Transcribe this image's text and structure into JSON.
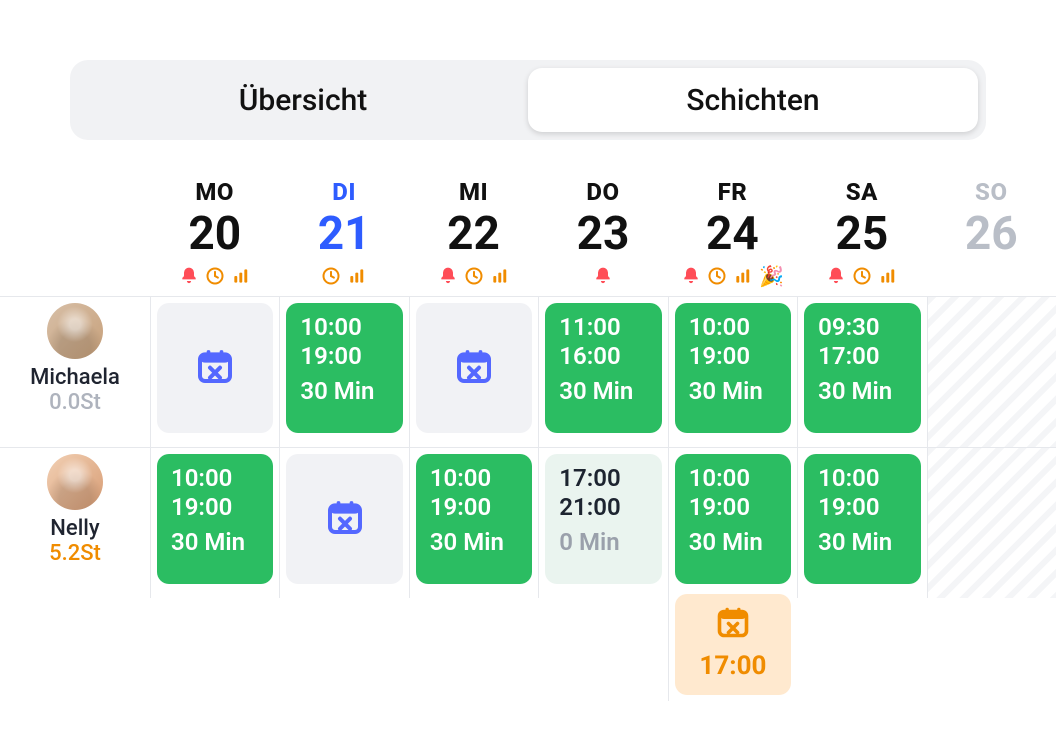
{
  "tabs": {
    "overview": "Übersicht",
    "shifts": "Schichten",
    "active": "shifts"
  },
  "days": [
    {
      "dow": "MO",
      "num": "20",
      "today": false,
      "muted": false,
      "inds": [
        "bell",
        "clock",
        "bars"
      ]
    },
    {
      "dow": "DI",
      "num": "21",
      "today": true,
      "muted": false,
      "inds": [
        "clock",
        "bars"
      ]
    },
    {
      "dow": "MI",
      "num": "22",
      "today": false,
      "muted": false,
      "inds": [
        "bell",
        "clock",
        "bars"
      ]
    },
    {
      "dow": "DO",
      "num": "23",
      "today": false,
      "muted": false,
      "inds": [
        "bell"
      ]
    },
    {
      "dow": "FR",
      "num": "24",
      "today": false,
      "muted": false,
      "inds": [
        "bell",
        "clock",
        "bars",
        "party"
      ]
    },
    {
      "dow": "SA",
      "num": "25",
      "today": false,
      "muted": false,
      "inds": [
        "bell",
        "clock",
        "bars"
      ]
    },
    {
      "dow": "SO",
      "num": "26",
      "today": false,
      "muted": true,
      "inds": []
    }
  ],
  "employees": [
    {
      "name": "Michaela",
      "hours": "0.0St",
      "hoursColor": "gray",
      "cells": [
        {
          "type": "busy"
        },
        {
          "type": "shift",
          "start": "10:00",
          "end": "19:00",
          "dur": "30 Min",
          "variant": "green"
        },
        {
          "type": "busy"
        },
        {
          "type": "shift",
          "start": "11:00",
          "end": "16:00",
          "dur": "30 Min",
          "variant": "green"
        },
        {
          "type": "shift",
          "start": "10:00",
          "end": "19:00",
          "dur": "30 Min",
          "variant": "green"
        },
        {
          "type": "shift",
          "start": "09:30",
          "end": "17:00",
          "dur": "30 Min",
          "variant": "green"
        },
        {
          "type": "hatched"
        }
      ]
    },
    {
      "name": "Nelly",
      "hours": "5.2St",
      "hoursColor": "orange",
      "cells": [
        {
          "type": "shift",
          "start": "10:00",
          "end": "19:00",
          "dur": "30 Min",
          "variant": "green"
        },
        {
          "type": "busy"
        },
        {
          "type": "shift",
          "start": "10:00",
          "end": "19:00",
          "dur": "30 Min",
          "variant": "green"
        },
        {
          "type": "shift",
          "start": "17:00",
          "end": "21:00",
          "dur": "0 Min",
          "variant": "pale"
        },
        {
          "type": "shift",
          "start": "10:00",
          "end": "19:00",
          "dur": "30 Min",
          "variant": "green",
          "extra": {
            "time": "17:00"
          }
        },
        {
          "type": "shift",
          "start": "10:00",
          "end": "19:00",
          "dur": "30 Min",
          "variant": "green"
        },
        {
          "type": "hatched"
        }
      ]
    }
  ],
  "icons": {
    "bell": "bell-icon",
    "clock": "clock-icon",
    "bars": "bars-icon",
    "party": "party-popper-icon",
    "calendarX": "calendar-x-icon"
  }
}
